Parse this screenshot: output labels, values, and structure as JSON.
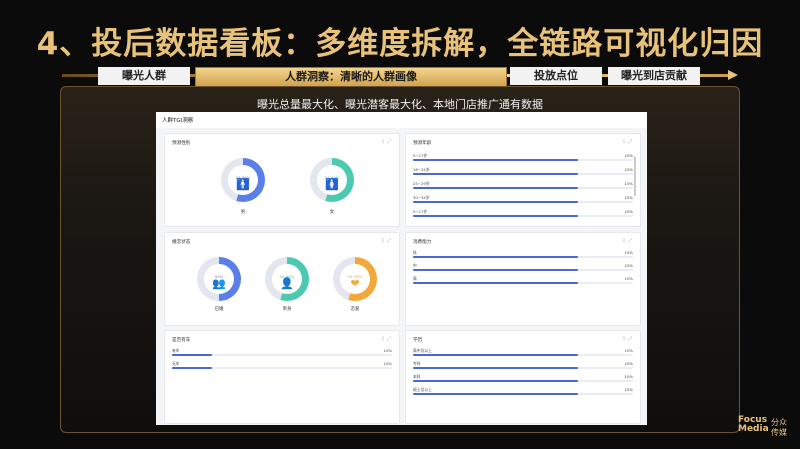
{
  "slide": {
    "title": "4、投后数据看板：多维度拆解，全链路可视化归因",
    "tabs": [
      "曝光人群",
      "人群洞察：清晰的人群画像",
      "投放点位",
      "曝光到店贡献"
    ],
    "panel_title": "曝光总量最大化、曝光潜客最大化、本地门店推广通有数据",
    "brand_top": "Focus",
    "brand_bottom": "Media",
    "brand_cn_1": "分众",
    "brand_cn_2": "传媒"
  },
  "dashboard": {
    "header": "人群TGI洞察",
    "gender": {
      "title": "预测性别",
      "items": [
        {
          "label": "男",
          "pct": "54.99%",
          "value": 54.99,
          "color": "#5b7fe8",
          "icon": "male-icon",
          "glyph": "🚹"
        },
        {
          "label": "女",
          "pct": "54.99%",
          "value": 54.99,
          "color": "#4cc9b0",
          "icon": "female-icon",
          "glyph": "🚺"
        }
      ]
    },
    "age": {
      "title": "预测年龄",
      "rows": [
        {
          "label": "0~17岁",
          "value": "10%",
          "fill": 0.75
        },
        {
          "label": "18~24岁",
          "value": "10%",
          "fill": 0.75
        },
        {
          "label": "25~29岁",
          "value": "10%",
          "fill": 0.75
        },
        {
          "label": "30~34岁",
          "value": "10%",
          "fill": 0.75
        },
        {
          "label": "0~17岁",
          "value": "10%",
          "fill": 0.75
        }
      ]
    },
    "marital": {
      "title": "婚恋状态",
      "items": [
        {
          "label": "已婚",
          "pct": "50%",
          "value": 50,
          "color": "#5b7fe8",
          "icon": "couple-icon",
          "glyph": "👥"
        },
        {
          "label": "单身",
          "pct": "54.99%",
          "value": 54.99,
          "color": "#4cc9b0",
          "icon": "single-person-icon",
          "glyph": "👤"
        },
        {
          "label": "恋爱",
          "pct": "54.99%",
          "value": 54.99,
          "color": "#f3a83b",
          "icon": "heart-icon",
          "glyph": "❤"
        }
      ]
    },
    "consumption": {
      "title": "消费能力",
      "rows": [
        {
          "label": "低",
          "value": "10%",
          "fill": 0.75
        },
        {
          "label": "中",
          "value": "10%",
          "fill": 0.75
        },
        {
          "label": "高",
          "value": "10%",
          "fill": 0.75
        }
      ]
    },
    "car": {
      "title": "是否有车",
      "rows": [
        {
          "label": "有车",
          "value": "10%",
          "fill": 0.18
        },
        {
          "label": "无车",
          "value": "10%",
          "fill": 0.18
        }
      ]
    },
    "education": {
      "title": "学历",
      "rows": [
        {
          "label": "高中及以上",
          "value": "10%",
          "fill": 0.75
        },
        {
          "label": "专科",
          "value": "10%",
          "fill": 0.75
        },
        {
          "label": "本科",
          "value": "10%",
          "fill": 0.75
        },
        {
          "label": "硕士及以上",
          "value": "10%",
          "fill": 0.75
        }
      ]
    },
    "card_icons": {
      "download": "download-icon",
      "expand": "expand-icon"
    }
  }
}
